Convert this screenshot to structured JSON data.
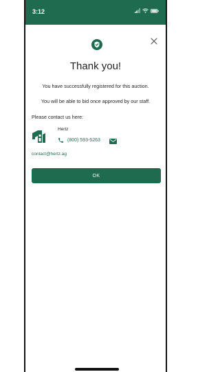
{
  "status_bar": {
    "time": "3:12",
    "icons": [
      "signal-icon",
      "wifi-icon",
      "battery-icon"
    ],
    "background_color": "#1e6b4f"
  },
  "dialog": {
    "success_icon": "shield-check-icon",
    "close_icon": "close-icon",
    "title": "Thank you!",
    "message_registered": "You have successfully registered for this auction.",
    "message_approval": "You will be able to bid once approved by our staff.",
    "contact_heading": "Please contact us here:",
    "ok_label": "OK"
  },
  "contact": {
    "logo": "hertz-logo",
    "company_name": "Hertz",
    "phone": "(800) 593-5263",
    "phone_icon": "phone-icon",
    "mail_icon": "mail-icon",
    "email": "contact@hertz.ag"
  },
  "colors": {
    "accent": "#1e6b4f",
    "text": "#222222"
  }
}
